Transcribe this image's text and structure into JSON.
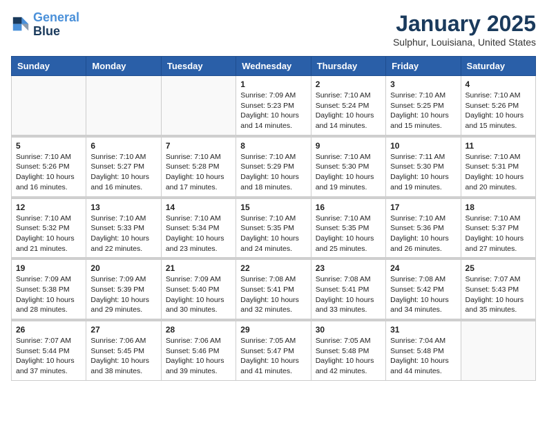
{
  "header": {
    "logo_line1": "General",
    "logo_line2": "Blue",
    "title": "January 2025",
    "subtitle": "Sulphur, Louisiana, United States"
  },
  "days_of_week": [
    "Sunday",
    "Monday",
    "Tuesday",
    "Wednesday",
    "Thursday",
    "Friday",
    "Saturday"
  ],
  "weeks": [
    {
      "days": [
        {
          "number": "",
          "info": ""
        },
        {
          "number": "",
          "info": ""
        },
        {
          "number": "",
          "info": ""
        },
        {
          "number": "1",
          "info": "Sunrise: 7:09 AM\nSunset: 5:23 PM\nDaylight: 10 hours\nand 14 minutes."
        },
        {
          "number": "2",
          "info": "Sunrise: 7:10 AM\nSunset: 5:24 PM\nDaylight: 10 hours\nand 14 minutes."
        },
        {
          "number": "3",
          "info": "Sunrise: 7:10 AM\nSunset: 5:25 PM\nDaylight: 10 hours\nand 15 minutes."
        },
        {
          "number": "4",
          "info": "Sunrise: 7:10 AM\nSunset: 5:26 PM\nDaylight: 10 hours\nand 15 minutes."
        }
      ]
    },
    {
      "days": [
        {
          "number": "5",
          "info": "Sunrise: 7:10 AM\nSunset: 5:26 PM\nDaylight: 10 hours\nand 16 minutes."
        },
        {
          "number": "6",
          "info": "Sunrise: 7:10 AM\nSunset: 5:27 PM\nDaylight: 10 hours\nand 16 minutes."
        },
        {
          "number": "7",
          "info": "Sunrise: 7:10 AM\nSunset: 5:28 PM\nDaylight: 10 hours\nand 17 minutes."
        },
        {
          "number": "8",
          "info": "Sunrise: 7:10 AM\nSunset: 5:29 PM\nDaylight: 10 hours\nand 18 minutes."
        },
        {
          "number": "9",
          "info": "Sunrise: 7:10 AM\nSunset: 5:30 PM\nDaylight: 10 hours\nand 19 minutes."
        },
        {
          "number": "10",
          "info": "Sunrise: 7:11 AM\nSunset: 5:30 PM\nDaylight: 10 hours\nand 19 minutes."
        },
        {
          "number": "11",
          "info": "Sunrise: 7:10 AM\nSunset: 5:31 PM\nDaylight: 10 hours\nand 20 minutes."
        }
      ]
    },
    {
      "days": [
        {
          "number": "12",
          "info": "Sunrise: 7:10 AM\nSunset: 5:32 PM\nDaylight: 10 hours\nand 21 minutes."
        },
        {
          "number": "13",
          "info": "Sunrise: 7:10 AM\nSunset: 5:33 PM\nDaylight: 10 hours\nand 22 minutes."
        },
        {
          "number": "14",
          "info": "Sunrise: 7:10 AM\nSunset: 5:34 PM\nDaylight: 10 hours\nand 23 minutes."
        },
        {
          "number": "15",
          "info": "Sunrise: 7:10 AM\nSunset: 5:35 PM\nDaylight: 10 hours\nand 24 minutes."
        },
        {
          "number": "16",
          "info": "Sunrise: 7:10 AM\nSunset: 5:35 PM\nDaylight: 10 hours\nand 25 minutes."
        },
        {
          "number": "17",
          "info": "Sunrise: 7:10 AM\nSunset: 5:36 PM\nDaylight: 10 hours\nand 26 minutes."
        },
        {
          "number": "18",
          "info": "Sunrise: 7:10 AM\nSunset: 5:37 PM\nDaylight: 10 hours\nand 27 minutes."
        }
      ]
    },
    {
      "days": [
        {
          "number": "19",
          "info": "Sunrise: 7:09 AM\nSunset: 5:38 PM\nDaylight: 10 hours\nand 28 minutes."
        },
        {
          "number": "20",
          "info": "Sunrise: 7:09 AM\nSunset: 5:39 PM\nDaylight: 10 hours\nand 29 minutes."
        },
        {
          "number": "21",
          "info": "Sunrise: 7:09 AM\nSunset: 5:40 PM\nDaylight: 10 hours\nand 30 minutes."
        },
        {
          "number": "22",
          "info": "Sunrise: 7:08 AM\nSunset: 5:41 PM\nDaylight: 10 hours\nand 32 minutes."
        },
        {
          "number": "23",
          "info": "Sunrise: 7:08 AM\nSunset: 5:41 PM\nDaylight: 10 hours\nand 33 minutes."
        },
        {
          "number": "24",
          "info": "Sunrise: 7:08 AM\nSunset: 5:42 PM\nDaylight: 10 hours\nand 34 minutes."
        },
        {
          "number": "25",
          "info": "Sunrise: 7:07 AM\nSunset: 5:43 PM\nDaylight: 10 hours\nand 35 minutes."
        }
      ]
    },
    {
      "days": [
        {
          "number": "26",
          "info": "Sunrise: 7:07 AM\nSunset: 5:44 PM\nDaylight: 10 hours\nand 37 minutes."
        },
        {
          "number": "27",
          "info": "Sunrise: 7:06 AM\nSunset: 5:45 PM\nDaylight: 10 hours\nand 38 minutes."
        },
        {
          "number": "28",
          "info": "Sunrise: 7:06 AM\nSunset: 5:46 PM\nDaylight: 10 hours\nand 39 minutes."
        },
        {
          "number": "29",
          "info": "Sunrise: 7:05 AM\nSunset: 5:47 PM\nDaylight: 10 hours\nand 41 minutes."
        },
        {
          "number": "30",
          "info": "Sunrise: 7:05 AM\nSunset: 5:48 PM\nDaylight: 10 hours\nand 42 minutes."
        },
        {
          "number": "31",
          "info": "Sunrise: 7:04 AM\nSunset: 5:48 PM\nDaylight: 10 hours\nand 44 minutes."
        },
        {
          "number": "",
          "info": ""
        }
      ]
    }
  ]
}
